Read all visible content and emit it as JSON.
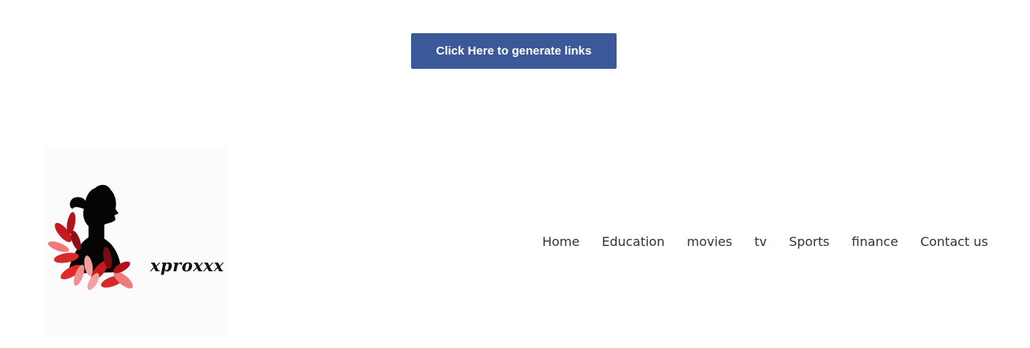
{
  "header": {
    "generate_button_label": "Click Here to generate links"
  },
  "site": {
    "logo_text": "xproxxx"
  },
  "nav": {
    "items": [
      {
        "label": "Home"
      },
      {
        "label": "Education"
      },
      {
        "label": "movies"
      },
      {
        "label": "tv"
      },
      {
        "label": "Sports"
      },
      {
        "label": "finance"
      },
      {
        "label": "Contact us"
      }
    ]
  },
  "colors": {
    "button_bg": "#3b5998",
    "button_text": "#ffffff",
    "nav_text": "#333333",
    "petal_dark": "#b3121c",
    "petal_light": "#f07b7b"
  }
}
